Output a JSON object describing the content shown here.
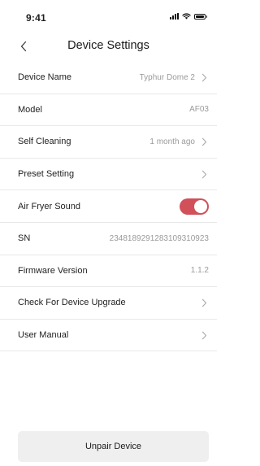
{
  "status_bar": {
    "time": "9:41"
  },
  "header": {
    "title": "Device Settings"
  },
  "settings": [
    {
      "id": "device-name",
      "label": "Device Name",
      "value": "Typhur Dome 2",
      "chevron": true
    },
    {
      "id": "model",
      "label": "Model",
      "value": "AF03",
      "chevron": false
    },
    {
      "id": "self-cleaning",
      "label": "Self Cleaning",
      "value": "1 month ago",
      "chevron": true
    },
    {
      "id": "preset-setting",
      "label": "Preset Setting",
      "value": "",
      "chevron": true
    },
    {
      "id": "air-fryer-sound",
      "label": "Air Fryer Sound",
      "toggle": true,
      "toggle_on": true
    },
    {
      "id": "sn",
      "label": "SN",
      "value": "2348189291283109310923",
      "chevron": false
    },
    {
      "id": "firmware-version",
      "label": "Firmware Version",
      "value": "1.1.2",
      "chevron": false
    },
    {
      "id": "check-upgrade",
      "label": "Check For Device Upgrade",
      "value": "",
      "chevron": true
    },
    {
      "id": "user-manual",
      "label": "User Manual",
      "value": "",
      "chevron": true
    }
  ],
  "footer": {
    "unpair_label": "Unpair Device"
  },
  "colors": {
    "toggle_on": "#d1505a",
    "divider": "#e8e8e8",
    "secondary_text": "#9a9a9a",
    "button_bg": "#f0efef"
  },
  "icons": {
    "back": "chevron-left-icon",
    "row": "chevron-right-icon",
    "signal": "cellular-signal-icon",
    "wifi": "wifi-icon",
    "battery": "battery-icon"
  }
}
